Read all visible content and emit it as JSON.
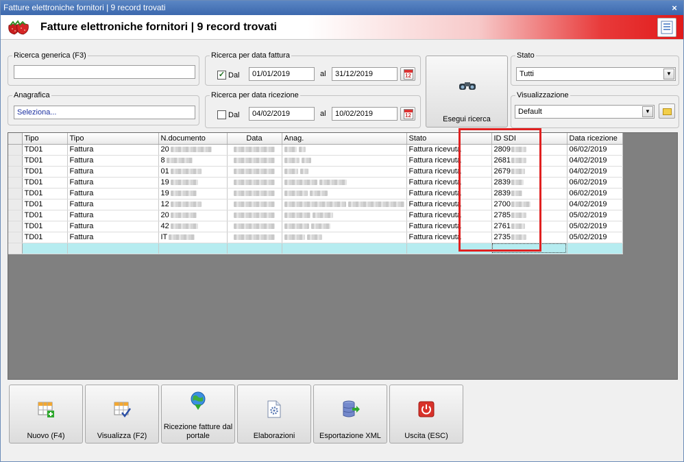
{
  "window": {
    "title": "Fatture elettroniche fornitori | 9 record trovati"
  },
  "banner": {
    "title": "Fatture elettroniche fornitori | 9 record trovati"
  },
  "search": {
    "generic_label": "Ricerca generica (F3)",
    "generic_value": "",
    "anagrafica_label": "Anagrafica",
    "anagrafica_value": "Seleziona...",
    "invoice_date": {
      "label": "Ricerca per data fattura",
      "dal_label": "Dal",
      "al_label": "al",
      "from": "01/01/2019",
      "to": "31/12/2019",
      "checked": true
    },
    "receipt_date": {
      "label": "Ricerca per data ricezione",
      "dal_label": "Dal",
      "al_label": "al",
      "from": "04/02/2019",
      "to": "10/02/2019",
      "checked": false
    },
    "execute_label": "Esegui ricerca",
    "stato_label": "Stato",
    "stato_value": "Tutti",
    "view_label": "Visualizzazione",
    "view_value": "Default"
  },
  "grid": {
    "columns": [
      "Tipo",
      "Tipo",
      "N.documento",
      "Data",
      "Anag.",
      "Stato",
      "ID SDI",
      "Data ricezione"
    ],
    "rows": [
      {
        "tipo": "TD01",
        "tipo2": "Fattura",
        "ndoc": "20",
        "stato": "Fattura ricevuta",
        "idsdi": "2809",
        "ricezione": "06/02/2019"
      },
      {
        "tipo": "TD01",
        "tipo2": "Fattura",
        "ndoc": "8",
        "stato": "Fattura ricevuta",
        "idsdi": "2681",
        "ricezione": "04/02/2019"
      },
      {
        "tipo": "TD01",
        "tipo2": "Fattura",
        "ndoc": "01",
        "stato": "Fattura ricevuta",
        "idsdi": "2679",
        "ricezione": "04/02/2019"
      },
      {
        "tipo": "TD01",
        "tipo2": "Fattura",
        "ndoc": "19",
        "stato": "Fattura ricevuta",
        "idsdi": "2839",
        "ricezione": "06/02/2019"
      },
      {
        "tipo": "TD01",
        "tipo2": "Fattura",
        "ndoc": "19",
        "stato": "Fattura ricevuta",
        "idsdi": "2839",
        "ricezione": "06/02/2019"
      },
      {
        "tipo": "TD01",
        "tipo2": "Fattura",
        "ndoc": "12",
        "stato": "Fattura ricevuta",
        "idsdi": "2700",
        "ricezione": "04/02/2019"
      },
      {
        "tipo": "TD01",
        "tipo2": "Fattura",
        "ndoc": "20",
        "stato": "Fattura ricevuta",
        "idsdi": "2785",
        "ricezione": "05/02/2019"
      },
      {
        "tipo": "TD01",
        "tipo2": "Fattura",
        "ndoc": "42",
        "stato": "Fattura ricevuta",
        "idsdi": "2761",
        "ricezione": "05/02/2019"
      },
      {
        "tipo": "TD01",
        "tipo2": "Fattura",
        "ndoc": "IT",
        "stato": "Fattura ricevuta",
        "idsdi": "2735",
        "ricezione": "05/02/2019"
      }
    ]
  },
  "actions": {
    "new": "Nuovo (F4)",
    "view": "Visualizza (F2)",
    "receive": "Ricezione fatture dal portale",
    "process": "Elaborazioni",
    "export": "Esportazione XML",
    "exit": "Uscita (ESC)"
  },
  "colors": {
    "title_bar": "#3c68ad",
    "banner_red": "#e11a1a",
    "highlight": "#e02020",
    "new_row": "#b6ecf0"
  }
}
